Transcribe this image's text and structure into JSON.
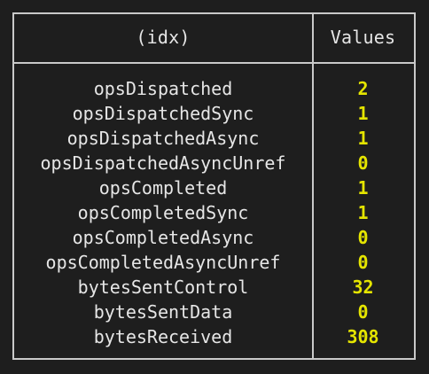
{
  "table": {
    "headers": {
      "index": "(idx)",
      "values": "Values"
    },
    "rows": [
      {
        "key": "opsDispatched",
        "value": "2"
      },
      {
        "key": "opsDispatchedSync",
        "value": "1"
      },
      {
        "key": "opsDispatchedAsync",
        "value": "1"
      },
      {
        "key": "opsDispatchedAsyncUnref",
        "value": "0"
      },
      {
        "key": "opsCompleted",
        "value": "1"
      },
      {
        "key": "opsCompletedSync",
        "value": "1"
      },
      {
        "key": "opsCompletedAsync",
        "value": "0"
      },
      {
        "key": "opsCompletedAsyncUnref",
        "value": "0"
      },
      {
        "key": "bytesSentControl",
        "value": "32"
      },
      {
        "key": "bytesSentData",
        "value": "0"
      },
      {
        "key": "bytesReceived",
        "value": "308"
      }
    ]
  },
  "colors": {
    "background": "#1e1e1e",
    "text": "#e6e6e6",
    "value": "#e5e500",
    "border": "#c9c9c9"
  }
}
